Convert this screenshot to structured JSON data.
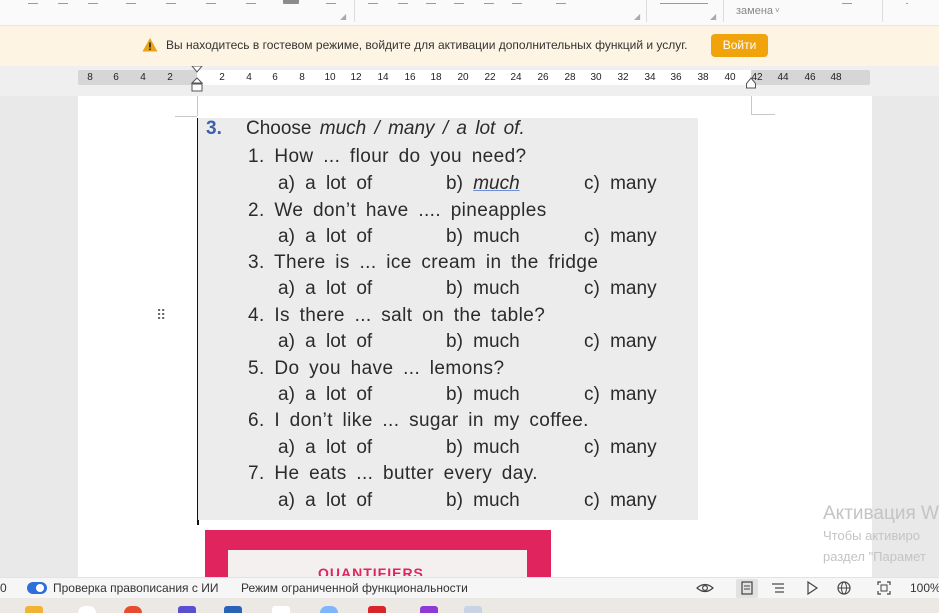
{
  "toolbar": {
    "replace_label": "замена",
    "replace_chevron": "˅"
  },
  "banner": {
    "text": "Вы находитесь в гостевом режиме, войдите для активации дополнительных функций и услуг.",
    "login_label": "Войти",
    "icon": "warning-icon",
    "accent_color": "#f0a30a"
  },
  "ruler": {
    "numbers": [
      "8",
      "6",
      "4",
      "2",
      "2",
      "4",
      "6",
      "8",
      "10",
      "12",
      "14",
      "16",
      "18",
      "20",
      "22",
      "24",
      "26",
      "28",
      "30",
      "32",
      "34",
      "36",
      "38",
      "40",
      "42",
      "44",
      "46",
      "48"
    ]
  },
  "exercise": {
    "number": "3.",
    "title_pre": "Choose",
    "title_much": "much",
    "title_sep1": "/",
    "title_many": "many",
    "title_sep2": "/",
    "title_alot": "a lot of.",
    "questions": [
      {
        "q": "1. How ... flour do you need?",
        "a": "a) a lot of",
        "b": "b)",
        "b_word": "much",
        "c": "c) many"
      },
      {
        "q": "2. We don’t have .... pineapples",
        "a": "a) a lot of",
        "b": "b) much",
        "c": "c) many"
      },
      {
        "q": "3. There is ... ice cream in the fridge",
        "a": "a) a lot of",
        "b": "b) much",
        "c": "c) many"
      },
      {
        "q": "4. Is there ... salt on the table?",
        "a": "a) a lot of",
        "b": "b) much",
        "c": "c) many"
      },
      {
        "q": "5. Do you have ... lemons?",
        "a": "a) a lot of",
        "b": "b) much",
        "c": "c) many"
      },
      {
        "q": "6. I don’t like ... sugar in my coffee.",
        "a": "a) a lot of",
        "b": "b) much",
        "c": "c) many"
      },
      {
        "q": "7. He eats ... butter every day.",
        "a": "a) a lot of",
        "b": "b) much",
        "c": "c) many"
      }
    ],
    "next_heading": "QUANTIFIERS"
  },
  "activation": {
    "title": "Активация W",
    "line1": "Чтобы активиро",
    "line2": "раздел \"Парамет"
  },
  "statusbar": {
    "page_num": "0",
    "spellcheck_label": "Проверка правописания с ИИ",
    "mode_label": "Режим ограниченной функциональности",
    "zoom": "100%",
    "toggle_color": "#2f6fd9"
  }
}
